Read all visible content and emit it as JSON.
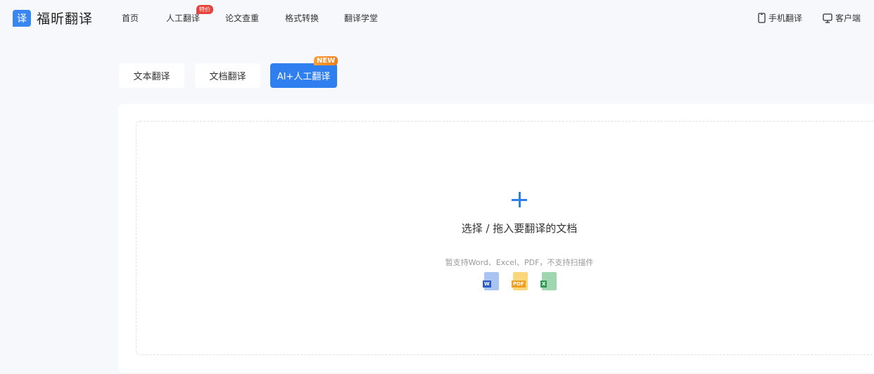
{
  "header": {
    "logo_mark": "译",
    "logo_text": "福昕翻译",
    "nav": [
      {
        "label": "首页"
      },
      {
        "label": "人工翻译",
        "badge": "特价"
      },
      {
        "label": "论文查重"
      },
      {
        "label": "格式转换"
      },
      {
        "label": "翻译学堂"
      }
    ],
    "right": [
      {
        "label": "手机翻译",
        "icon": "phone-icon"
      },
      {
        "label": "客户端",
        "icon": "monitor-icon"
      }
    ]
  },
  "tabs": [
    {
      "label": "文本翻译"
    },
    {
      "label": "文档翻译"
    },
    {
      "label": "AI+人工翻译",
      "badge": "NEW",
      "active": true
    }
  ],
  "upload": {
    "title": "选择 / 拖入要翻译的文档",
    "hint": "暂支持Word、Excel、PDF，不支持扫描件",
    "file_types": [
      {
        "label": "W",
        "color": "#2a5cc8"
      },
      {
        "label": "PDF",
        "color": "#f0a020"
      },
      {
        "label": "X",
        "color": "#2e9a52"
      }
    ]
  },
  "colors": {
    "accent": "#2f7ff0",
    "hot": "#e8433a",
    "new": "#f08a24"
  }
}
